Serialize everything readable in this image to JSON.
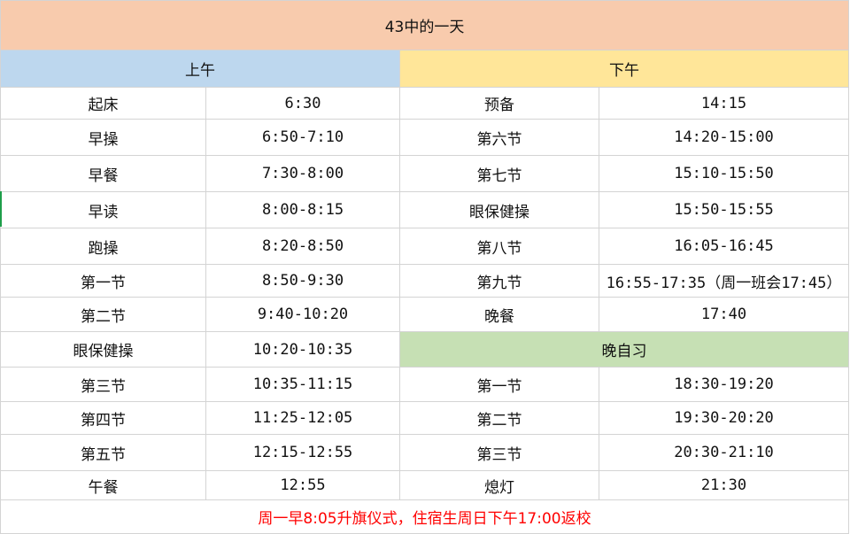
{
  "title": "43中的一天",
  "colors": {
    "title_bg": "#f8cbad",
    "morning_bg": "#bdd7ee",
    "afternoon_bg": "#ffe699",
    "evening_bg": "#c6e0b4",
    "footer_text": "#ff0000",
    "grid": "#d4d4d4"
  },
  "sections": {
    "morning": "上午",
    "afternoon": "下午",
    "evening": "晚自习"
  },
  "morning": [
    {
      "label": "起床",
      "time": "6:30"
    },
    {
      "label": "早操",
      "time": "6:50-7:10"
    },
    {
      "label": "早餐",
      "time": "7:30-8:00"
    },
    {
      "label": "早读",
      "time": "8:00-8:15"
    },
    {
      "label": "跑操",
      "time": "8:20-8:50"
    },
    {
      "label": "第一节",
      "time": "8:50-9:30"
    },
    {
      "label": "第二节",
      "time": "9:40-10:20"
    },
    {
      "label": "眼保健操",
      "time": "10:20-10:35"
    },
    {
      "label": "第三节",
      "time": "10:35-11:15"
    },
    {
      "label": "第四节",
      "time": "11:25-12:05"
    },
    {
      "label": "第五节",
      "time": "12:15-12:55"
    },
    {
      "label": "午餐",
      "time": "12:55"
    }
  ],
  "afternoon": [
    {
      "label": "预备",
      "time": "14:15"
    },
    {
      "label": "第六节",
      "time": "14:20-15:00"
    },
    {
      "label": "第七节",
      "time": "15:10-15:50"
    },
    {
      "label": "眼保健操",
      "time": "15:50-15:55"
    },
    {
      "label": "第八节",
      "time": "16:05-16:45"
    },
    {
      "label": "第九节",
      "time": "16:55-17:35（周一班会17:45）"
    },
    {
      "label": "晚餐",
      "time": "17:40"
    }
  ],
  "evening": [
    {
      "label": "第一节",
      "time": "18:30-19:20"
    },
    {
      "label": "第二节",
      "time": "19:30-20:20"
    },
    {
      "label": "第三节",
      "time": "20:30-21:10"
    },
    {
      "label": "熄灯",
      "time": "21:30"
    }
  ],
  "footer": "周一早8:05升旗仪式，住宿生周日下午17:00返校"
}
